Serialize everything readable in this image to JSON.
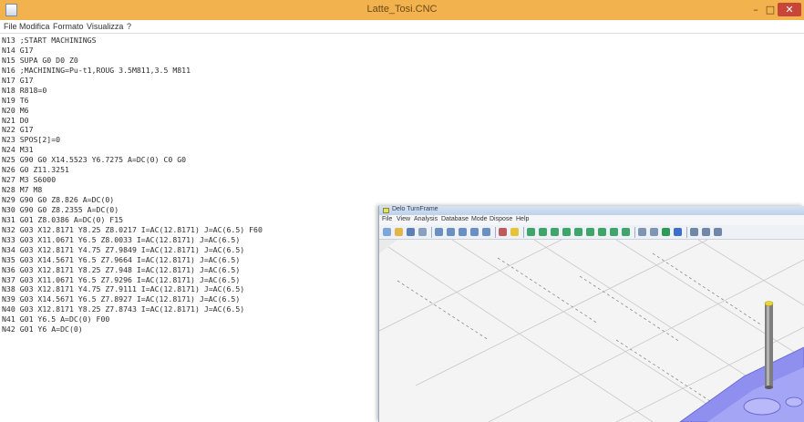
{
  "notepad": {
    "title": "Latte_Tosi.CNC",
    "menu": [
      "File",
      "Modifica",
      "Formato",
      "Visualizza",
      "?"
    ],
    "controls": {
      "minimize": "–",
      "maximize": "□",
      "close": "✕"
    },
    "lines": [
      "N13 ;START MACHININGS",
      "N14 G17",
      "N15 SUPA G0 D0 Z0",
      "N16 ;MACHINING=Pu-t1,ROUG 3.5M811,3.5 M811",
      "N17 G17",
      "N18 R818=0",
      "N19 T6",
      "N20 M6",
      "N21 D0",
      "N22 G17",
      "N23 SPOS[2]=0",
      "N24 M31",
      "N25 G90 G0 X14.5523 Y6.7275 A=DC(0) C0 G0",
      "N26 G0 Z11.3251",
      "N27 M3 S6000",
      "N28 M7 M8",
      "N29 G90 G0 Z8.826 A=DC(0)",
      "N30 G90 G0 Z8.2355 A=DC(0)",
      "N31 G01 Z8.0386 A=DC(0) F15",
      "N32 G03 X12.8171 Y8.25 Z8.0217 I=AC(12.8171) J=AC(6.5) F60",
      "N33 G03 X11.0671 Y6.5 Z8.0033 I=AC(12.8171) J=AC(6.5)",
      "N34 G03 X12.8171 Y4.75 Z7.9849 I=AC(12.8171) J=AC(6.5)",
      "N35 G03 X14.5671 Y6.5 Z7.9664 I=AC(12.8171) J=AC(6.5)",
      "N36 G03 X12.8171 Y8.25 Z7.948 I=AC(12.8171) J=AC(6.5)",
      "N37 G03 X11.0671 Y6.5 Z7.9296 I=AC(12.8171) J=AC(6.5)",
      "N38 G03 X12.8171 Y4.75 Z7.9111 I=AC(12.8171) J=AC(6.5)",
      "N39 G03 X14.5671 Y6.5 Z7.8927 I=AC(12.8171) J=AC(6.5)",
      "N40 G03 X12.8171 Y8.25 Z7.8743 I=AC(12.8171) J=AC(6.5)",
      "N41 G01 Y6.5 A=DC(0) F00",
      "N42 G01 Y6 A=DC(0)"
    ]
  },
  "cam": {
    "title": "Delo TurnFrame",
    "menu": [
      "File",
      "View",
      "Analysis",
      "Database",
      "Mode",
      "Dispose",
      "Help"
    ],
    "toolbar_icons": [
      {
        "name": "new-icon",
        "color": "#7da7d9"
      },
      {
        "name": "open-icon",
        "color": "#e3b54a"
      },
      {
        "name": "save-icon",
        "color": "#5b7fb8"
      },
      {
        "name": "print-icon",
        "color": "#8aa0bd"
      },
      {
        "name": "zoom-in-icon",
        "color": "#6a8fc2"
      },
      {
        "name": "zoom-out-icon",
        "color": "#6a8fc2"
      },
      {
        "name": "zoom-window-icon",
        "color": "#6a8fc2"
      },
      {
        "name": "zoom-fit-icon",
        "color": "#6a8fc2"
      },
      {
        "name": "pan-icon",
        "color": "#6a8fc2"
      },
      {
        "name": "rotate-icon",
        "color": "#c05b5b"
      },
      {
        "name": "light-icon",
        "color": "#e6c43a"
      },
      {
        "name": "view-front-icon",
        "color": "#3fa56a"
      },
      {
        "name": "view-back-icon",
        "color": "#3fa56a"
      },
      {
        "name": "view-left-icon",
        "color": "#3fa56a"
      },
      {
        "name": "view-right-icon",
        "color": "#3fa56a"
      },
      {
        "name": "view-top-icon",
        "color": "#3fa56a"
      },
      {
        "name": "view-bottom-icon",
        "color": "#3fa56a"
      },
      {
        "name": "view-iso-icon",
        "color": "#3fa56a"
      },
      {
        "name": "view-iso2-icon",
        "color": "#3fa56a"
      },
      {
        "name": "view-iso3-icon",
        "color": "#3fa56a"
      },
      {
        "name": "wireframe-icon",
        "color": "#7f95b5"
      },
      {
        "name": "hidden-lines-icon",
        "color": "#7f95b5"
      },
      {
        "name": "shaded-icon",
        "color": "#2f9a57"
      },
      {
        "name": "shaded-edges-icon",
        "color": "#3d6fc9"
      },
      {
        "name": "measure-icon",
        "color": "#6f87a8"
      },
      {
        "name": "section-icon",
        "color": "#6f87a8"
      },
      {
        "name": "layers-icon",
        "color": "#6f87a8"
      }
    ]
  }
}
